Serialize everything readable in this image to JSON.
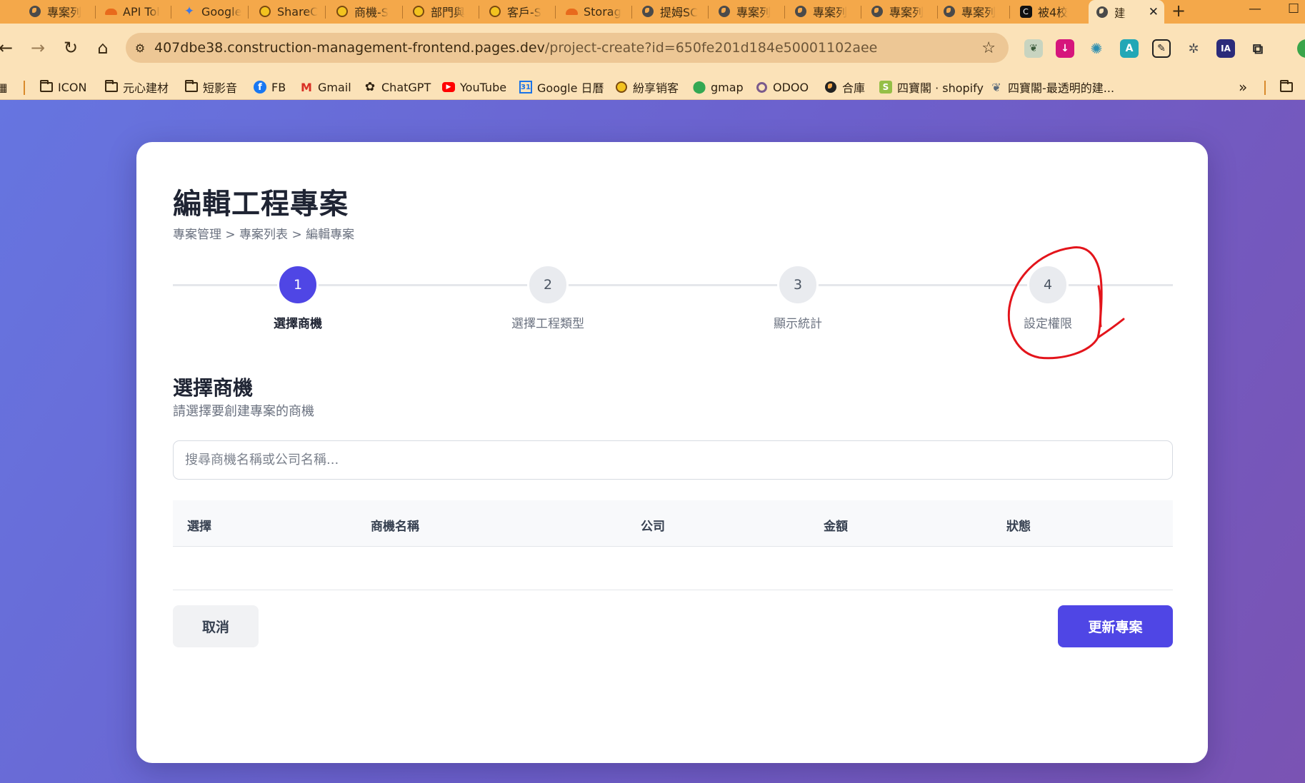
{
  "browser": {
    "tabs": [
      {
        "title": "專案列",
        "icon": "globe-icon"
      },
      {
        "title": "API Tol",
        "icon": "cloud-icon"
      },
      {
        "title": "Google",
        "icon": "gemini-icon"
      },
      {
        "title": "ShareC",
        "icon": "bee-icon"
      },
      {
        "title": "商機-S",
        "icon": "bee-icon"
      },
      {
        "title": "部門與",
        "icon": "bee-icon"
      },
      {
        "title": "客戶-S",
        "icon": "bee-icon"
      },
      {
        "title": "Storag",
        "icon": "cloud-icon"
      },
      {
        "title": "提姆SC",
        "icon": "globe-icon"
      },
      {
        "title": "專案列",
        "icon": "globe-icon"
      },
      {
        "title": "專案列",
        "icon": "globe-icon"
      },
      {
        "title": "專案列",
        "icon": "globe-icon"
      },
      {
        "title": "專案列",
        "icon": "globe-icon"
      },
      {
        "title": "被4校",
        "icon": "app-icon"
      },
      {
        "title": "建",
        "icon": "globe-icon",
        "active": true
      }
    ],
    "url_host": "407dbe38.construction-management-frontend.pages.dev",
    "url_path": "/project-create?id=650fe201d184e50001102aee",
    "bookmarks": [
      {
        "label": "ICON",
        "icon": "folder-icon"
      },
      {
        "label": "元心建材",
        "icon": "folder-icon"
      },
      {
        "label": "短影音",
        "icon": "folder-icon"
      },
      {
        "label": "FB",
        "icon": "facebook-icon"
      },
      {
        "label": "Gmail",
        "icon": "gmail-icon"
      },
      {
        "label": "ChatGPT",
        "icon": "chatgpt-icon"
      },
      {
        "label": "YouTube",
        "icon": "youtube-icon"
      },
      {
        "label": "Google 日曆",
        "icon": "calendar-icon"
      },
      {
        "label": "紛享销客",
        "icon": "bee-icon"
      },
      {
        "label": "gmap",
        "icon": "map-pin-icon"
      },
      {
        "label": "ODOO",
        "icon": "odoo-icon"
      },
      {
        "label": "合庫",
        "icon": "globe-icon"
      },
      {
        "label": "四寶閣 · shopify",
        "icon": "shopify-icon"
      },
      {
        "label": "四寶閣-最透明的建...",
        "icon": "butterfly-icon"
      }
    ],
    "bookmarks_more": "»"
  },
  "page": {
    "title": "編輯工程專案",
    "breadcrumb": "專案管理 > 專案列表 > 編輯專案",
    "steps": [
      {
        "number": "1",
        "label": "選擇商機",
        "active": true
      },
      {
        "number": "2",
        "label": "選擇工程類型",
        "active": false
      },
      {
        "number": "3",
        "label": "顯示統計",
        "active": false
      },
      {
        "number": "4",
        "label": "設定權限",
        "active": false
      }
    ],
    "section_title": "選擇商機",
    "section_subtitle": "請選擇要創建專案的商機",
    "search_placeholder": "搜尋商機名稱或公司名稱...",
    "table_headers": [
      "選擇",
      "商機名稱",
      "公司",
      "金額",
      "狀態"
    ],
    "cancel_label": "取消",
    "submit_label": "更新專案",
    "accent_color": "#4f46e5",
    "annotation_color": "#e3141b"
  }
}
